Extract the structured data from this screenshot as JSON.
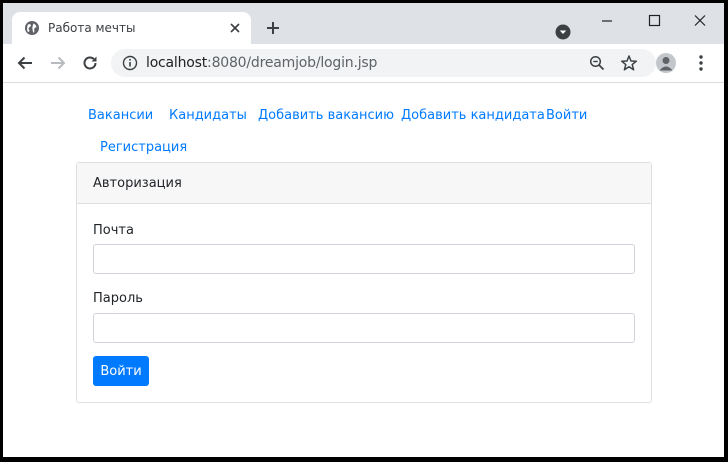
{
  "browser": {
    "tab_title": "Работа мечты",
    "url_host": "localhost",
    "url_path": ":8080/dreamjob/login.jsp"
  },
  "nav": {
    "vacancies": "Вакансии",
    "candidates": "Кандидаты",
    "add_vacancy": "Добавить вакансию",
    "add_candidate": "Добавить кандидата",
    "login": "Войти",
    "register": "Регистрация"
  },
  "card": {
    "title": "Авторизация",
    "email_label": "Почта",
    "email_value": "",
    "password_label": "Пароль",
    "password_value": "",
    "submit_label": "Войти"
  },
  "colors": {
    "link": "#007bff",
    "primary_button": "#007bff",
    "tab_strip": "#dee1e6"
  }
}
